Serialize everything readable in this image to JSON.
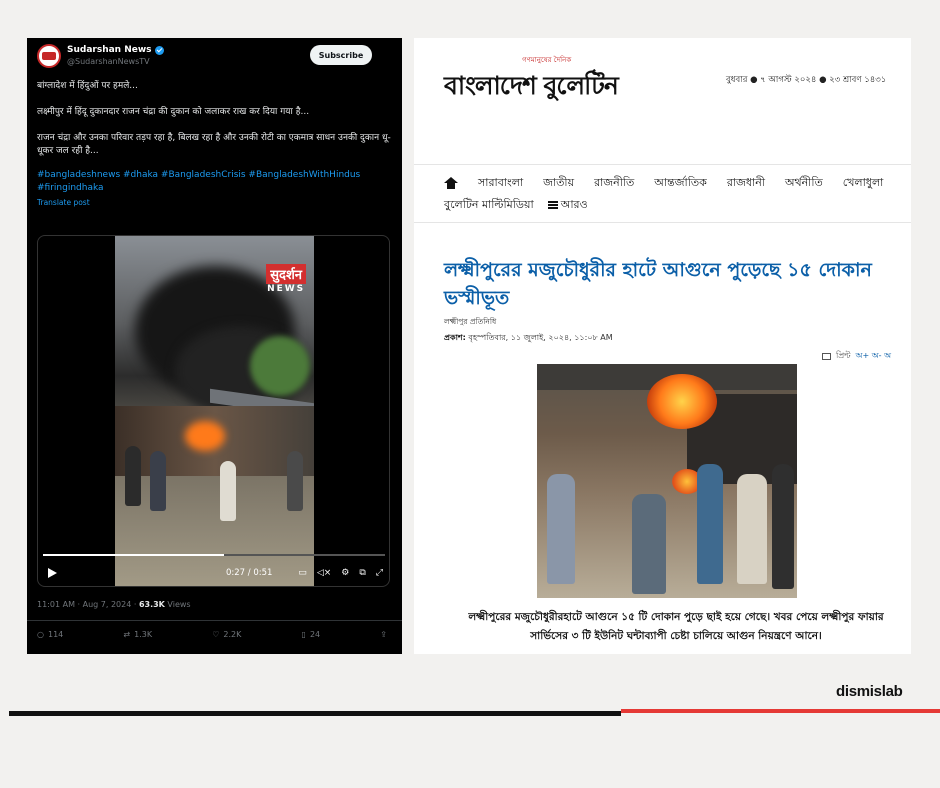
{
  "tweet": {
    "account_name": "Sudarshan News",
    "handle": "@SudarshanNewsTV",
    "subscribe_label": "Subscribe",
    "line1": "बांग्लादेश में हिंदुओं पर हमले...",
    "line2": "लक्ष्मीपुर में हिंदू दुकानदार राजन चंद्रा की दुकान को जलाकर राख कर दिया गया है...",
    "line3": "राजन चंद्रा और उनका परिवार तड़प रहा है, बिलख रहा है और उनकी रोटी का एकमात्र साधन उनकी दुकान धू-धूकर जल रही है...",
    "hashtags": "#bangladeshnews #dhaka #BangladeshCrisis #BangladeshWithHindus #firingindhaka",
    "translate_label": "Translate post",
    "video": {
      "watermark_top": "सुदर्शन",
      "watermark_bottom": "NEWS",
      "time": "0:27 / 0:51",
      "progress": 0.53
    },
    "timestamp": "11:01 AM · Aug 7, 2024 · ",
    "views_count": "63.3K",
    "views_label": " Views",
    "actions": {
      "replies": "114",
      "reposts": "1.3K",
      "likes": "2.2K",
      "bookmarks": "24"
    }
  },
  "news": {
    "small_tag": "গণমানুষের দৈনিক",
    "logo": "বাংলাদেশ বুলেটিন",
    "date": "বুধবার ● ৭ আগস্ট ২০২৪ ● ২৩ শ্রাবণ ১৪৩১",
    "nav_row1": [
      "সারাবাংলা",
      "জাতীয়",
      "রাজনীতি",
      "আন্তর্জাতিক",
      "রাজধানী",
      "অর্থনীতি",
      "খেলাধুলা"
    ],
    "nav_row2_item": "বুলেটিন মাল্টিমিডিয়া",
    "more_label": "আরও",
    "headline": "লক্ষ্মীপুরের মজুচৌধুরীর হাটে আগুনে পুড়েছে ১৫ দোকান ভস্মীভূত",
    "byline": "লক্ষ্মীপুর প্রতিনিধি",
    "published_label": "প্রকাশ:",
    "published_value": " বৃহস্পতিবার, ১১ জুলাই, ২০২৪, ১১:০৮ AM",
    "print_label": "প্রিন্ট",
    "font_sizes": "অ+ অ- অ",
    "caption": "লক্ষ্মীপুরের মজুচৌধুরীরহাটে আগুনে ১৫ টি দোকান পুড়ে ছাই হয়ে গেছে। খবর পেয়ে লক্ষ্মীপুর ফায়ার সার্ভিসের ৩ টি ইউনিট ঘন্টাব্যাপী চেষ্টা চালিয়ে আগুন নিয়ন্ত্রণে আনে।"
  },
  "brand": "dismislab",
  "colors": {
    "accent_red": "#e53935",
    "twitter_blue": "#1d9bf0",
    "headline_blue": "#0b5fa8"
  }
}
